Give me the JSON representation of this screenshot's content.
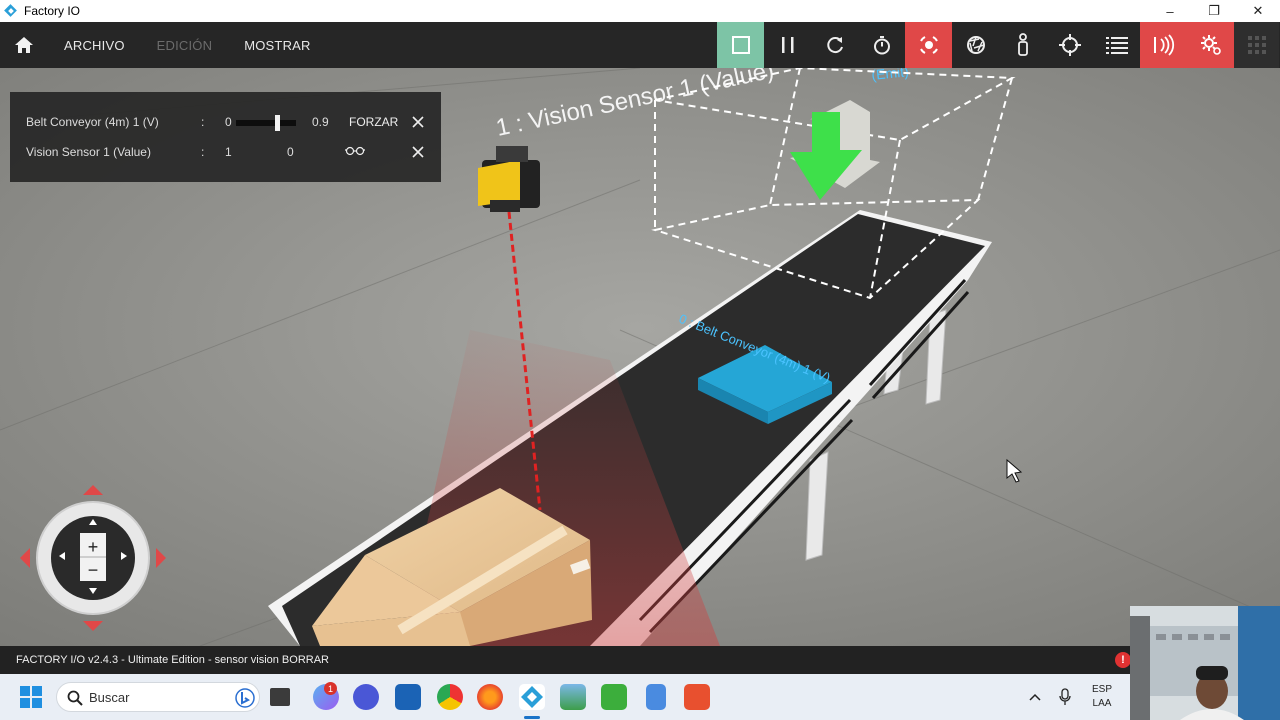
{
  "window": {
    "title": "Factory IO",
    "controls": {
      "minimize": "–",
      "restore": "❐",
      "close": "✕"
    }
  },
  "toolbar": {
    "menus": [
      {
        "label": "ARCHIVO",
        "enabled": true
      },
      {
        "label": "EDICIÓN",
        "enabled": false
      },
      {
        "label": "MOSTRAR",
        "enabled": true
      }
    ],
    "tools": [
      {
        "name": "stop-icon",
        "state": "active",
        "color": "#7dc4a6"
      },
      {
        "name": "pause-icon"
      },
      {
        "name": "reset-icon"
      },
      {
        "name": "timer-icon"
      },
      {
        "name": "sensor-view-icon",
        "state": "active",
        "color": "#e04848"
      },
      {
        "name": "aperture-icon"
      },
      {
        "name": "first-person-icon"
      },
      {
        "name": "crosshair-icon"
      },
      {
        "name": "list-icon"
      },
      {
        "name": "io-signal-icon",
        "state": "active",
        "color": "#e04848"
      },
      {
        "name": "drivers-gear-icon",
        "state": "active",
        "color": "#e04848"
      },
      {
        "name": "apps-grid-icon"
      }
    ]
  },
  "tag_panel": {
    "rows": [
      {
        "name": "Belt Conveyor (4m) 1 (V)",
        "sep": ":",
        "value": "0",
        "slider_level": 0.9,
        "slider_value": "0.9",
        "action": "FORZAR",
        "close": "X"
      },
      {
        "name": "Vision Sensor 1 (Value)",
        "sep": ":",
        "value": "1",
        "forced_value": "0",
        "action_icon": "glasses-icon",
        "close": "X"
      }
    ]
  },
  "scene": {
    "labels": {
      "vision_sensor": "1 : Vision Sensor 1 (Value)",
      "vision_sensor_top": "(Emit)",
      "belt_conveyor": "0 : Belt Conveyor (4m) 1 (V)"
    },
    "colors": {
      "floor": "#8a8a86",
      "belt": "#2b2b2b",
      "emitter_arrow": "#3ee04a",
      "blue_pallet": "#25a6d6",
      "box": "#e7c191",
      "laser": "#e02222",
      "sensor_head": "#f0c419"
    }
  },
  "navigator": {
    "zoom_in": "+",
    "zoom_out": "−"
  },
  "status": {
    "text": "FACTORY I/O v2.4.3 - Ultimate Edition - sensor  vision  BORRAR",
    "alert": "!"
  },
  "taskbar": {
    "search_placeholder": "Buscar",
    "badge": "1",
    "lang_top": "ESP",
    "lang_bottom": "LAA",
    "apps": [
      "file-explorer-icon",
      "copilot-icon",
      "zoom-icon",
      "festo-icon",
      "chrome-icon",
      "firefox-icon",
      "factory-io-icon",
      "image-viewer-icon",
      "camtasia-icon",
      "notepad-icon",
      "codesys-icon"
    ]
  }
}
